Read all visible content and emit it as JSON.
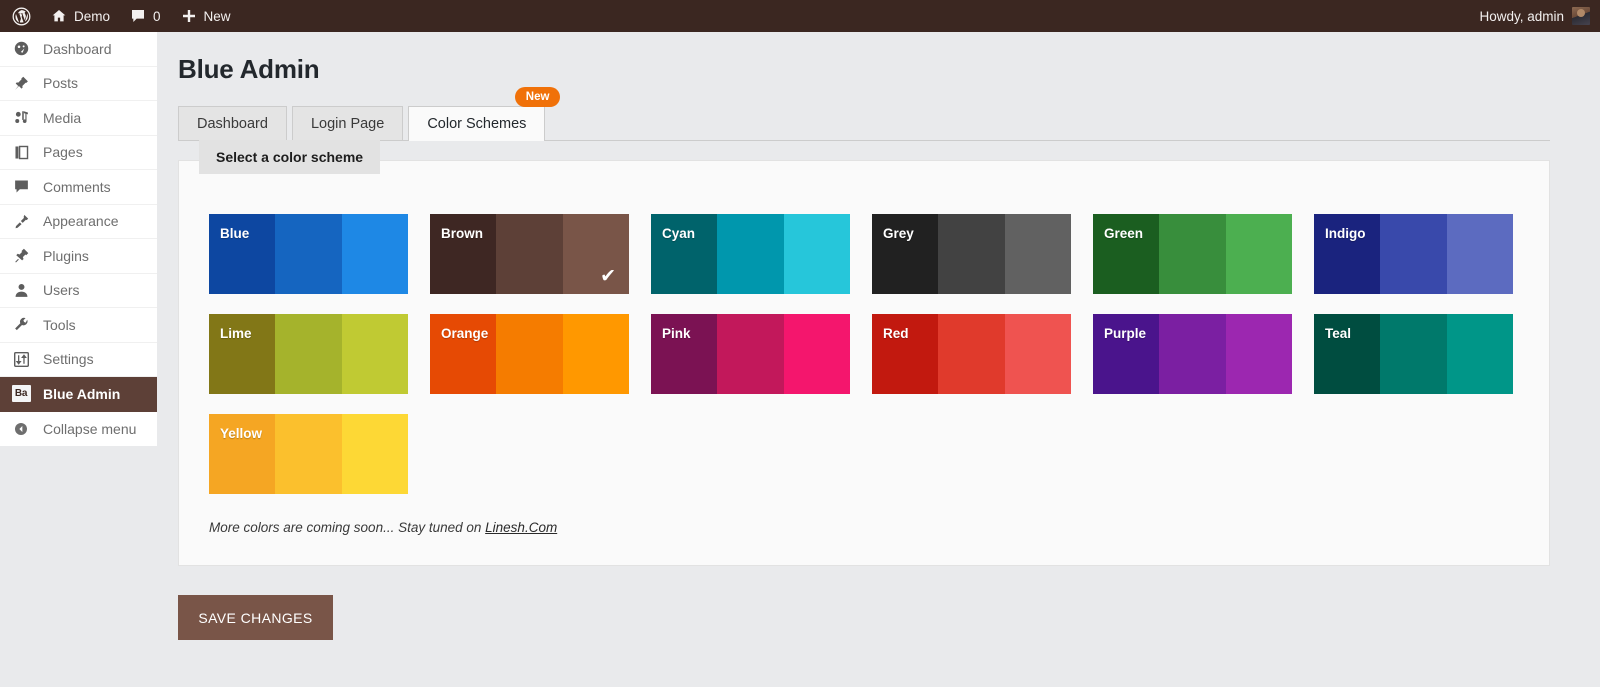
{
  "adminbar": {
    "wp_logo_icon": "wordpress-logo-icon",
    "site_icon": "home-icon",
    "site_name": "Demo",
    "comments_icon": "comment-bubble-icon",
    "comments_count": "0",
    "new_icon": "plus-icon",
    "new_label": "New",
    "howdy": "Howdy, admin",
    "avatar_icon": "user-avatar"
  },
  "sidebar": {
    "items": [
      {
        "label": "Dashboard",
        "icon": "dashboard-icon",
        "active": false
      },
      {
        "label": "Posts",
        "icon": "pin-icon",
        "active": false
      },
      {
        "label": "Media",
        "icon": "media-icon",
        "active": false
      },
      {
        "label": "Pages",
        "icon": "pages-icon",
        "active": false
      },
      {
        "label": "Comments",
        "icon": "comment-icon",
        "active": false
      },
      {
        "label": "Appearance",
        "icon": "brush-icon",
        "active": false
      },
      {
        "label": "Plugins",
        "icon": "plug-icon",
        "active": false
      },
      {
        "label": "Users",
        "icon": "user-icon",
        "active": false
      },
      {
        "label": "Tools",
        "icon": "wrench-icon",
        "active": false
      },
      {
        "label": "Settings",
        "icon": "sliders-icon",
        "active": false
      },
      {
        "label": "Blue Admin",
        "icon": "ba-badge-icon",
        "active": true,
        "badge_text": "Ba"
      }
    ],
    "collapse": {
      "label": "Collapse menu",
      "icon": "collapse-arrow-icon"
    }
  },
  "page": {
    "title": "Blue Admin"
  },
  "tabs": [
    {
      "label": "Dashboard",
      "active": false
    },
    {
      "label": "Login Page",
      "active": false
    },
    {
      "label": "Color Schemes",
      "active": true,
      "badge": "New"
    }
  ],
  "panel": {
    "heading": "Select a color scheme",
    "footnote_text": "More colors are coming soon... Stay tuned on ",
    "footnote_link": "Linesh.Com"
  },
  "schemes": [
    {
      "name": "Blue",
      "bands": [
        "#0d47a1",
        "#1565c0",
        "#1e88e5"
      ],
      "selected": false
    },
    {
      "name": "Brown",
      "bands": [
        "#3e2723",
        "#5d4037",
        "#795548"
      ],
      "selected": true,
      "check_icon": "checkmark-icon"
    },
    {
      "name": "Cyan",
      "bands": [
        "#00636b",
        "#0097ad",
        "#26c6da"
      ],
      "selected": false
    },
    {
      "name": "Grey",
      "bands": [
        "#212121",
        "#424242",
        "#616161"
      ],
      "selected": false
    },
    {
      "name": "Green",
      "bands": [
        "#1b5e20",
        "#388e3c",
        "#4caf50"
      ],
      "selected": false
    },
    {
      "name": "Indigo",
      "bands": [
        "#1a237e",
        "#3949ab",
        "#5c6bc0"
      ],
      "selected": false
    },
    {
      "name": "Lime",
      "bands": [
        "#827717",
        "#a5b32c",
        "#c0ca33"
      ],
      "selected": false
    },
    {
      "name": "Orange",
      "bands": [
        "#e64a04",
        "#f57c00",
        "#ff9800"
      ],
      "selected": false
    },
    {
      "name": "Pink",
      "bands": [
        "#7b1253",
        "#c2185b",
        "#f4166d"
      ],
      "selected": false
    },
    {
      "name": "Red",
      "bands": [
        "#c2190f",
        "#e03a2c",
        "#ef5350"
      ],
      "selected": false
    },
    {
      "name": "Purple",
      "bands": [
        "#4a148c",
        "#7b1fa2",
        "#9c27b0"
      ],
      "selected": false
    },
    {
      "name": "Teal",
      "bands": [
        "#004d40",
        "#00796b",
        "#009688"
      ],
      "selected": false
    },
    {
      "name": "Yellow",
      "bands": [
        "#f5a623",
        "#fbc02d",
        "#fdd835"
      ],
      "selected": false
    }
  ],
  "save": {
    "label": "SAVE CHANGES",
    "color": "#795548"
  }
}
